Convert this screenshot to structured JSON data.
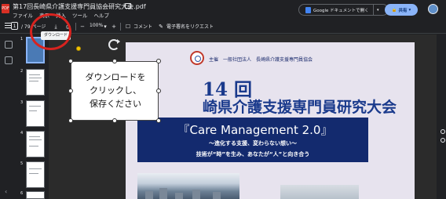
{
  "window": {
    "pdf_badge": "PDF",
    "title": "第17回長崎県介護支援専門員協会研究大会.pdf",
    "menu": [
      "ファイル",
      "表示",
      "挿入",
      "ツール",
      "ヘルプ"
    ],
    "open_with_label": "Google ドキュメントで開く",
    "caret": "▾",
    "share_label": "共有",
    "share_icon": "🔒"
  },
  "toolbar": {
    "current_page": "1",
    "page_total": "/ 79  ページ",
    "zoom": "100%",
    "zoom_minus": "−",
    "zoom_plus": "+",
    "zoom_caret": "▾",
    "comment_label": "コメント",
    "signature_label": "電子署名をリクエスト",
    "download_tooltip": "ダウンロード"
  },
  "sidebar": {
    "thumb_numbers": [
      "1",
      "2",
      "3",
      "4",
      "5",
      "6"
    ],
    "collapse_icon": "‹"
  },
  "document": {
    "organizer": "主催　一般社団法人　長崎県介護支援専門員協会",
    "edition": "14 回",
    "title": "崎県介護支援専門員研究大会",
    "theme_title": "『Care Management 2.0』",
    "subtitle1": "〜進化する支援、変わらない想い〜",
    "subtitle2": "技術が“時”を生み、あなたが“人”と向き合う"
  },
  "callout": {
    "lines": [
      "ダウンロードを",
      "クリックし、",
      "保存ください"
    ]
  },
  "colors": {
    "accent_blue": "#8ab4f8",
    "annotation_red": "#d8231f",
    "title_navy": "#132a6e"
  }
}
